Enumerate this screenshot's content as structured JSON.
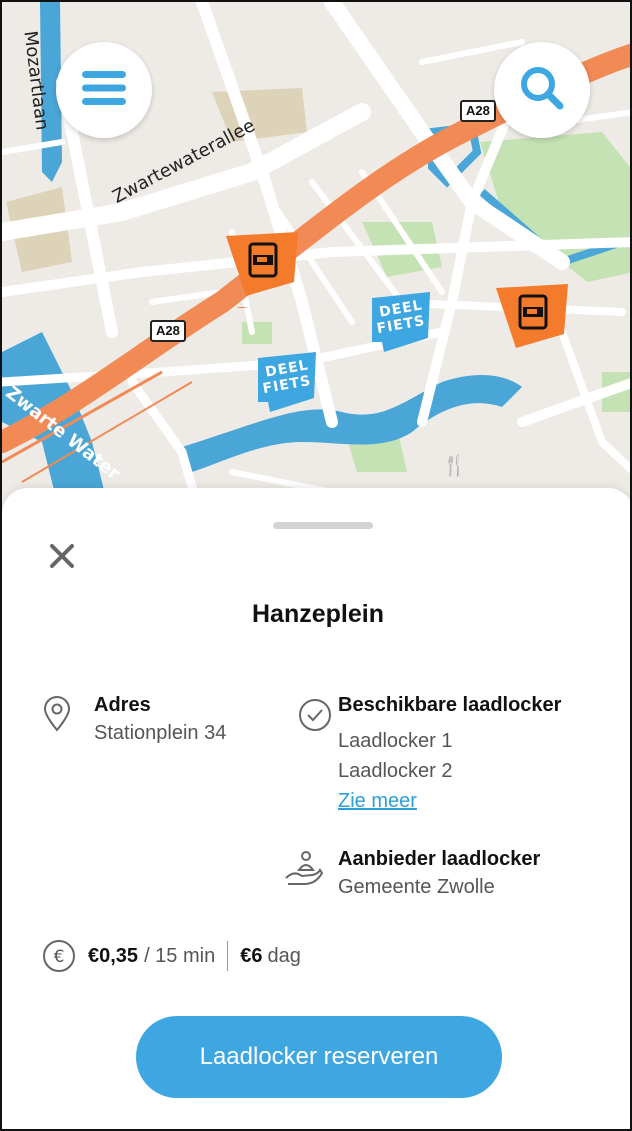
{
  "map": {
    "streets": {
      "mozartlaan": "Mozartlaan",
      "zwartewaterallee": "Zwartewaterallee",
      "zwarte_water": "Zwarte Water"
    },
    "road_shield": "A28",
    "deelfiets_label": [
      "DEEL",
      "FIETS"
    ],
    "menu_icon": "hamburger-icon",
    "search_icon": "search-icon"
  },
  "sheet": {
    "title": "Hanzeplein",
    "address": {
      "heading": "Adres",
      "value": "Stationplein 34",
      "icon": "location-pin-icon"
    },
    "availability": {
      "heading": "Beschikbare laadlocker",
      "items": [
        "Laadlocker 1",
        "Laadlocker 2"
      ],
      "more_link": "Zie meer",
      "icon": "check-circle-icon"
    },
    "provider": {
      "heading": "Aanbieder laadlocker",
      "value": "Gemeente Zwolle",
      "icon": "hand-person-icon"
    },
    "price": {
      "icon": "euro-icon",
      "per_period": "€0,35",
      "period": "/ 15 min",
      "day_price": "€6",
      "day_label": "dag"
    },
    "cta_label": "Laadlocker reserveren"
  },
  "colors": {
    "accent": "#3ea6e0",
    "locker_marker": "#f47a2c",
    "road": "#f28a55",
    "water": "#4aa6d6",
    "park": "#c4e2b3"
  }
}
